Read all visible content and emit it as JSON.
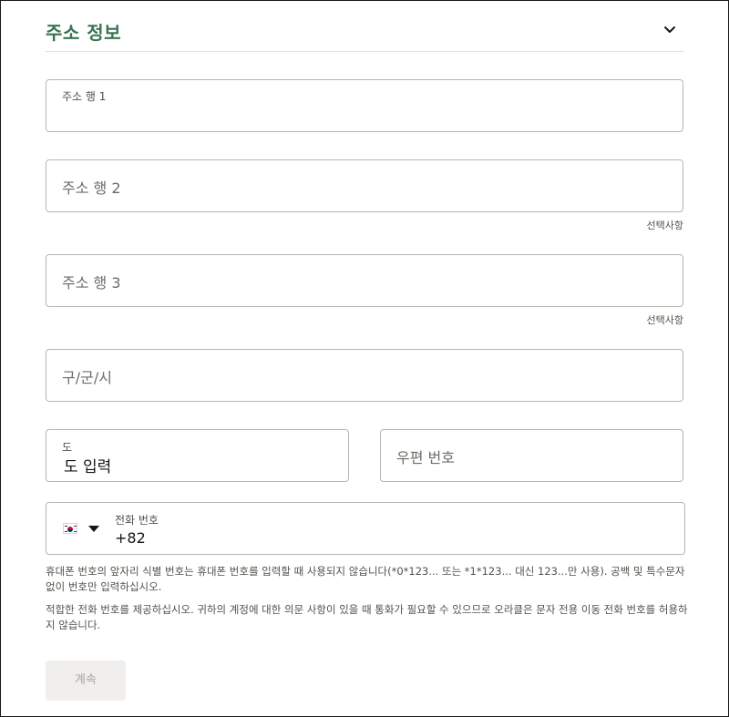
{
  "section": {
    "title": "주소 정보",
    "collapse_icon": "chevron-down-icon"
  },
  "fields": {
    "address_line1": {
      "label": "주소 행 1",
      "value": ""
    },
    "address_line2": {
      "placeholder": "주소 행 2",
      "optional_label": "선택사항"
    },
    "address_line3": {
      "placeholder": "주소 행 3",
      "optional_label": "선택사항"
    },
    "city": {
      "placeholder": "구/군/시"
    },
    "state": {
      "label": "도",
      "value": "도 입력"
    },
    "postal": {
      "placeholder": "우편 번호"
    },
    "phone": {
      "label": "전화 번호",
      "value": "+82",
      "country_flag": "south-korea-flag-icon"
    }
  },
  "help": {
    "phone_prefix_note": "휴대폰 번호의 앞자리 식별 번호는 휴대폰 번호를 입력할 때 사용되지 않습니다(*0*123... 또는 *1*123... 대신 123...만 사용). 공백 및 특수문자 없이 번호만 입력하십시오.",
    "phone_valid_note": "적합한 전화 번호를 제공하십시오. 귀하의 계정에 대한 의문 사항이 있을 때 통화가 필요할 수 있으므로 오라클은 문자 전용 이동 전화 번호를 허용하지 않습니다."
  },
  "actions": {
    "continue_label": "계속",
    "continue_enabled": false
  },
  "colors": {
    "accent": "#3a7454",
    "border": "#b9b5ae",
    "text": "#161513",
    "muted": "#6f6b66",
    "button_disabled_bg": "#f1efed"
  }
}
